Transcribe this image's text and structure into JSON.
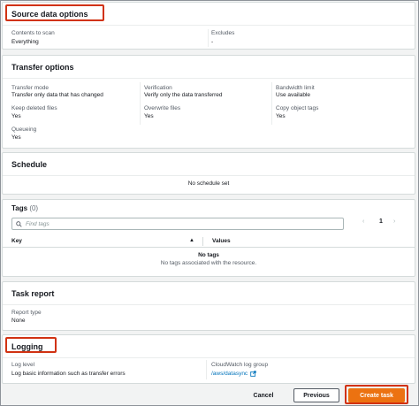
{
  "source": {
    "title": "Source data options",
    "contents_label": "Contents to scan",
    "contents_value": "Everything",
    "excludes_label": "Excludes",
    "excludes_value": "-"
  },
  "transfer": {
    "title": "Transfer options",
    "mode_label": "Transfer mode",
    "mode_value": "Transfer only data that has changed",
    "verification_label": "Verification",
    "verification_value": "Verify only the data transferred",
    "bandwidth_label": "Bandwidth limit",
    "bandwidth_value": "Use available",
    "keep_deleted_label": "Keep deleted files",
    "keep_deleted_value": "Yes",
    "overwrite_label": "Overwrite files",
    "overwrite_value": "Yes",
    "copy_tags_label": "Copy object tags",
    "copy_tags_value": "Yes",
    "queueing_label": "Queueing",
    "queueing_value": "Yes"
  },
  "schedule": {
    "title": "Schedule",
    "empty": "No schedule set"
  },
  "tags": {
    "title": "Tags",
    "count": "(0)",
    "search_placeholder": "Find tags",
    "page": "1",
    "prev_icon": "‹",
    "next_icon": "›",
    "col_key": "Key",
    "col_values": "Values",
    "sort_icon": "▲",
    "empty_title": "No tags",
    "empty_desc": "No tags associated with the resource."
  },
  "task_report": {
    "title": "Task report",
    "type_label": "Report type",
    "type_value": "None"
  },
  "logging": {
    "title": "Logging",
    "level_label": "Log level",
    "level_value": "Log basic information such as transfer errors",
    "group_label": "CloudWatch log group",
    "group_value": "/aws/datasync"
  },
  "footer": {
    "cancel": "Cancel",
    "previous": "Previous",
    "create": "Create task"
  },
  "colors": {
    "highlight": "#d13212",
    "primary": "#ec7211",
    "link": "#0073bb"
  }
}
